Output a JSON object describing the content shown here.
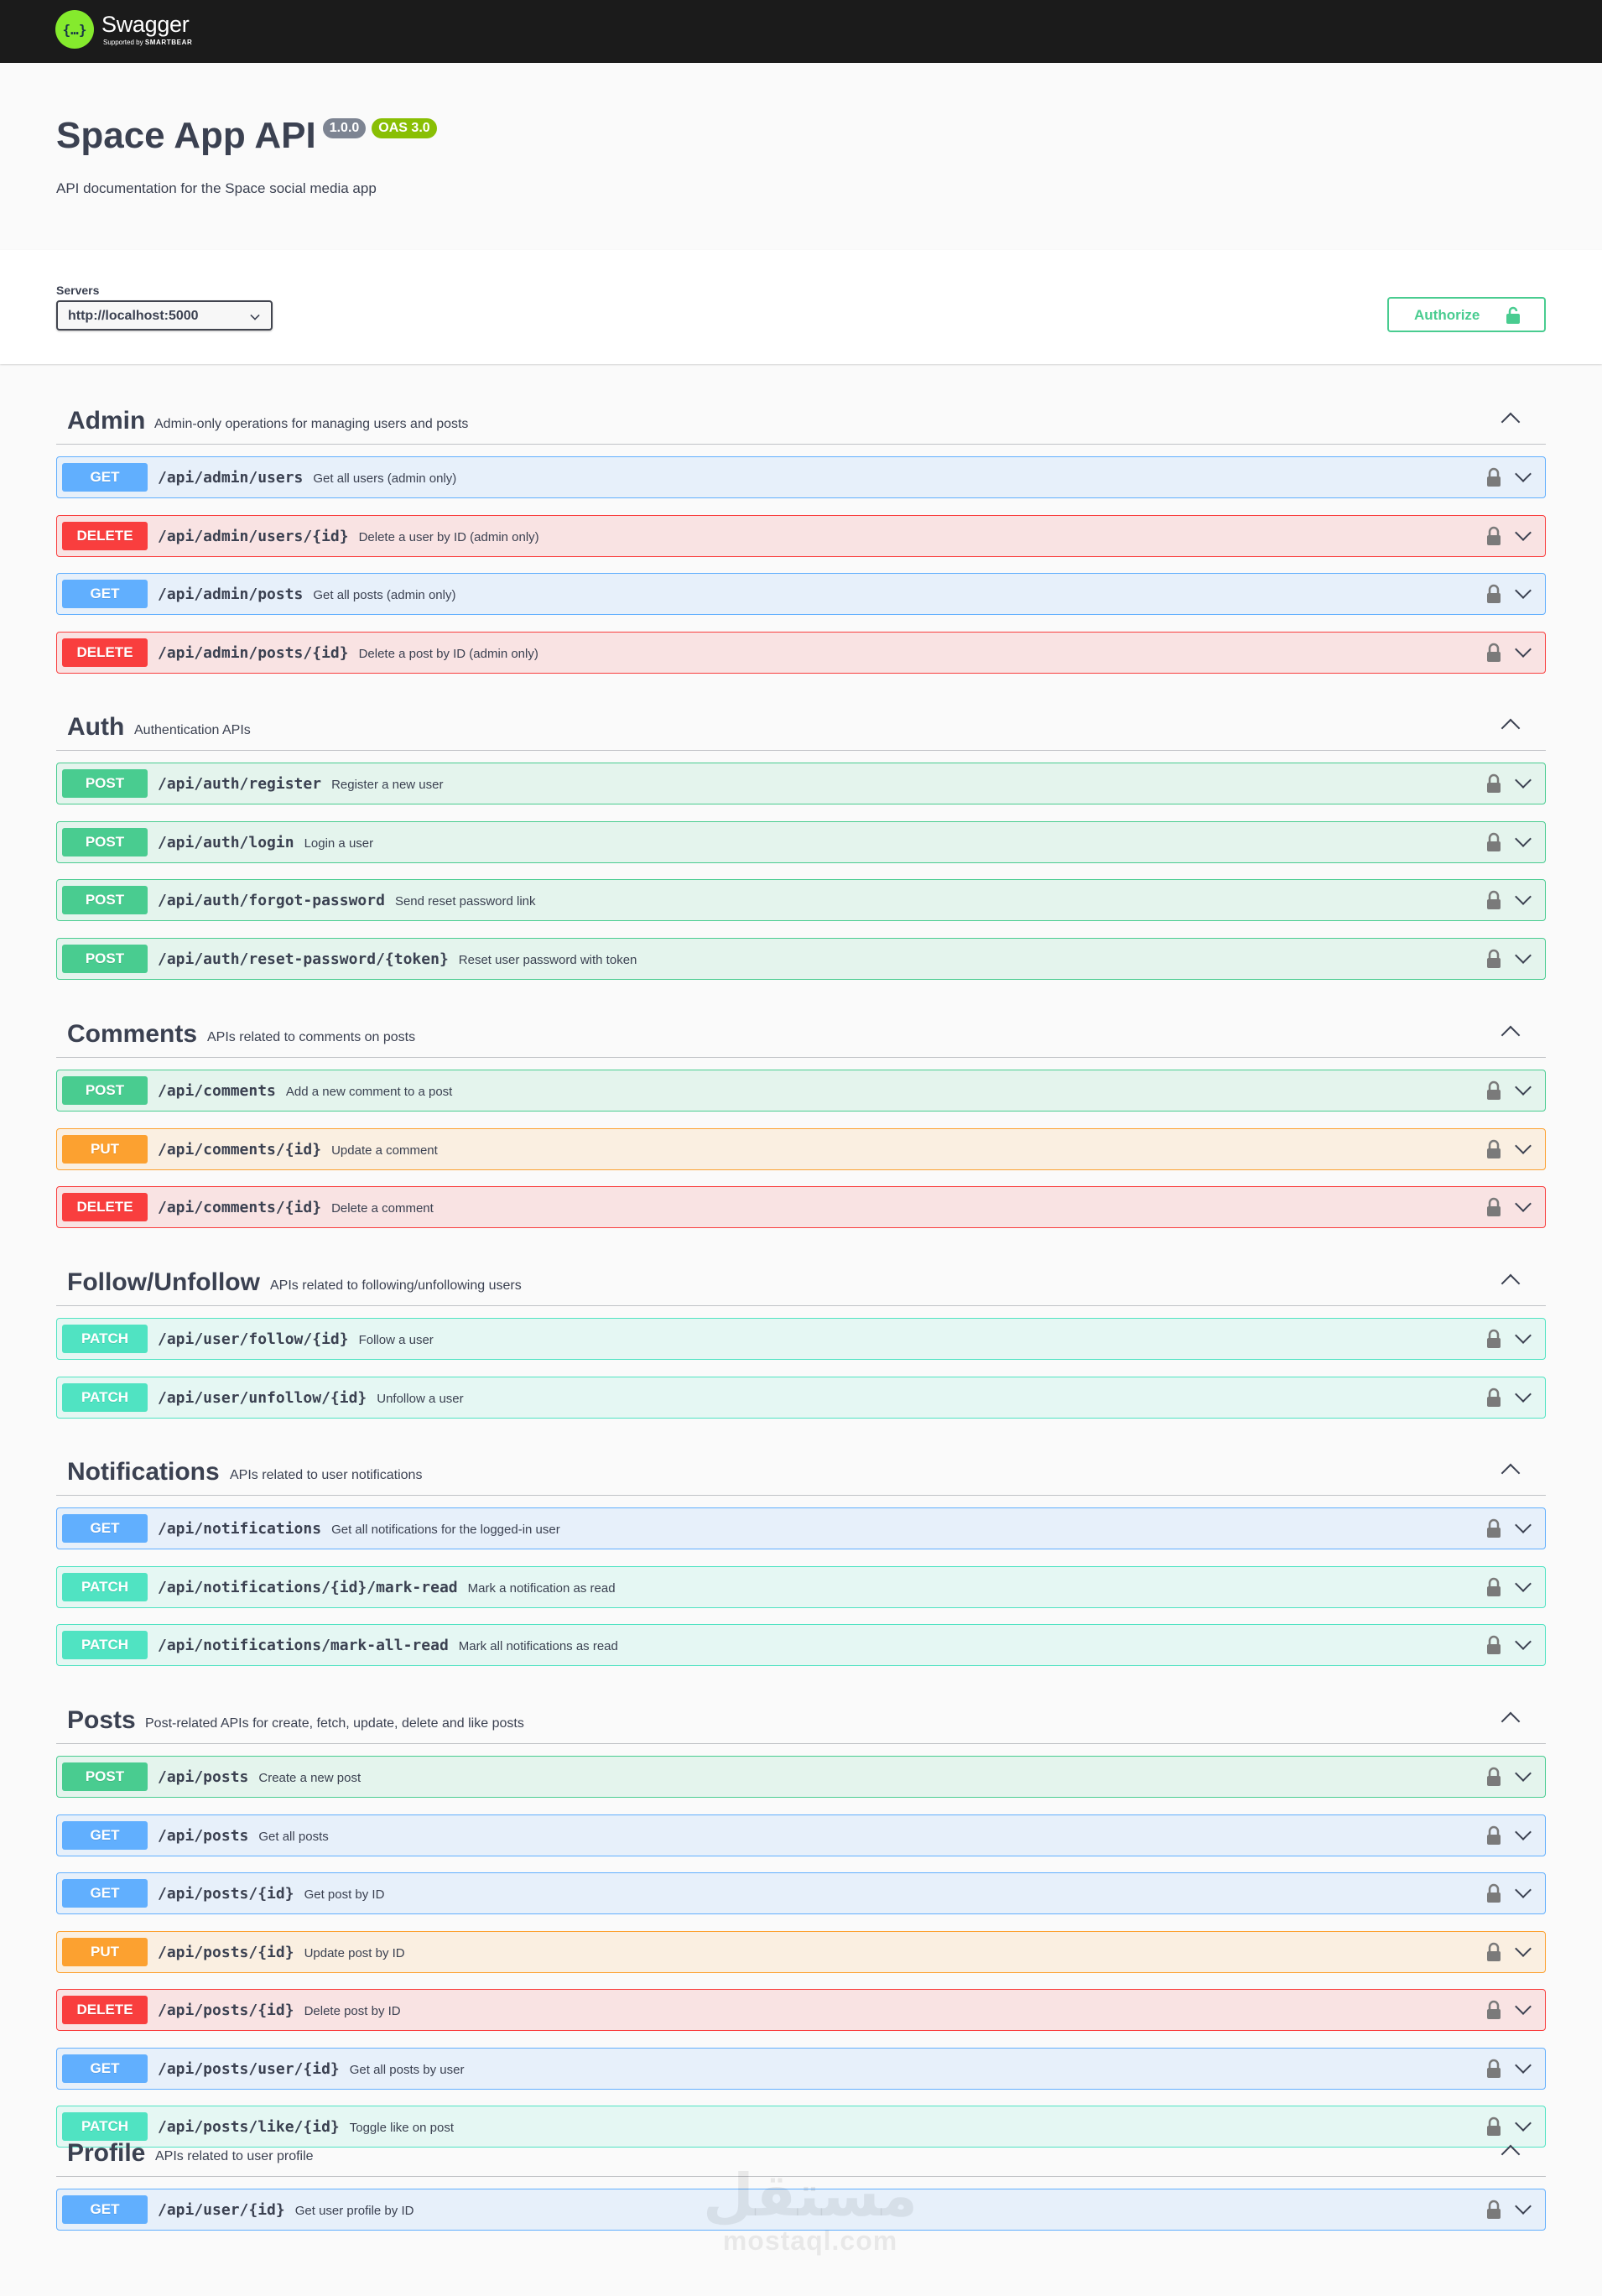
{
  "topbar": {
    "logo_name": "Swagger",
    "logo_icon_glyph": "{…}",
    "logo_sub_prefix": "Supported by",
    "logo_sub_brand": "SMARTBEAR"
  },
  "info": {
    "title": "Space App API",
    "version": "1.0.0",
    "oas": "OAS 3.0",
    "description": "API documentation for the Space social media app"
  },
  "servers": {
    "label": "Servers",
    "selected": "http://localhost:5000"
  },
  "authorize": {
    "label": "Authorize"
  },
  "colors": {
    "get": "#61affe",
    "post": "#49cc90",
    "delete": "#f93e3e",
    "put": "#fca130",
    "patch": "#50e3c2",
    "topbar": "#1b1b1b"
  },
  "sections": [
    {
      "name": "Admin",
      "description": "Admin-only operations for managing users and posts",
      "ops": [
        {
          "method": "GET",
          "path": "/api/admin/users",
          "summary": "Get all users (admin only)"
        },
        {
          "method": "DELETE",
          "path": "/api/admin/users/{id}",
          "summary": "Delete a user by ID (admin only)"
        },
        {
          "method": "GET",
          "path": "/api/admin/posts",
          "summary": "Get all posts (admin only)"
        },
        {
          "method": "DELETE",
          "path": "/api/admin/posts/{id}",
          "summary": "Delete a post by ID (admin only)"
        }
      ]
    },
    {
      "name": "Auth",
      "description": "Authentication APIs",
      "ops": [
        {
          "method": "POST",
          "path": "/api/auth/register",
          "summary": "Register a new user"
        },
        {
          "method": "POST",
          "path": "/api/auth/login",
          "summary": "Login a user"
        },
        {
          "method": "POST",
          "path": "/api/auth/forgot-password",
          "summary": "Send reset password link"
        },
        {
          "method": "POST",
          "path": "/api/auth/reset-password/{token}",
          "summary": "Reset user password with token"
        }
      ]
    },
    {
      "name": "Comments",
      "description": "APIs related to comments on posts",
      "ops": [
        {
          "method": "POST",
          "path": "/api/comments",
          "summary": "Add a new comment to a post"
        },
        {
          "method": "PUT",
          "path": "/api/comments/{id}",
          "summary": "Update a comment"
        },
        {
          "method": "DELETE",
          "path": "/api/comments/{id}",
          "summary": "Delete a comment"
        }
      ]
    },
    {
      "name": "Follow/Unfollow",
      "description": "APIs related to following/unfollowing users",
      "ops": [
        {
          "method": "PATCH",
          "path": "/api/user/follow/{id}",
          "summary": "Follow a user"
        },
        {
          "method": "PATCH",
          "path": "/api/user/unfollow/{id}",
          "summary": "Unfollow a user"
        }
      ]
    },
    {
      "name": "Notifications",
      "description": "APIs related to user notifications",
      "ops": [
        {
          "method": "GET",
          "path": "/api/notifications",
          "summary": "Get all notifications for the logged-in user"
        },
        {
          "method": "PATCH",
          "path": "/api/notifications/{id}/mark-read",
          "summary": "Mark a notification as read"
        },
        {
          "method": "PATCH",
          "path": "/api/notifications/mark-all-read",
          "summary": "Mark all notifications as read"
        }
      ]
    },
    {
      "name": "Posts",
      "description": "Post-related APIs for create, fetch, update, delete and like posts",
      "ops": [
        {
          "method": "POST",
          "path": "/api/posts",
          "summary": "Create a new post"
        },
        {
          "method": "GET",
          "path": "/api/posts",
          "summary": "Get all posts"
        },
        {
          "method": "GET",
          "path": "/api/posts/{id}",
          "summary": "Get post by ID"
        },
        {
          "method": "PUT",
          "path": "/api/posts/{id}",
          "summary": "Update post by ID"
        },
        {
          "method": "DELETE",
          "path": "/api/posts/{id}",
          "summary": "Delete post by ID"
        },
        {
          "method": "GET",
          "path": "/api/posts/user/{id}",
          "summary": "Get all posts by user"
        },
        {
          "method": "PATCH",
          "path": "/api/posts/like/{id}",
          "summary": "Toggle like on post"
        }
      ]
    },
    {
      "name": "Profile",
      "description": "APIs related to user profile",
      "ops": [
        {
          "method": "GET",
          "path": "/api/user/{id}",
          "summary": "Get user profile by ID"
        }
      ]
    }
  ],
  "watermark": {
    "arabic": "مستقل",
    "latin": "mostaql.com"
  }
}
